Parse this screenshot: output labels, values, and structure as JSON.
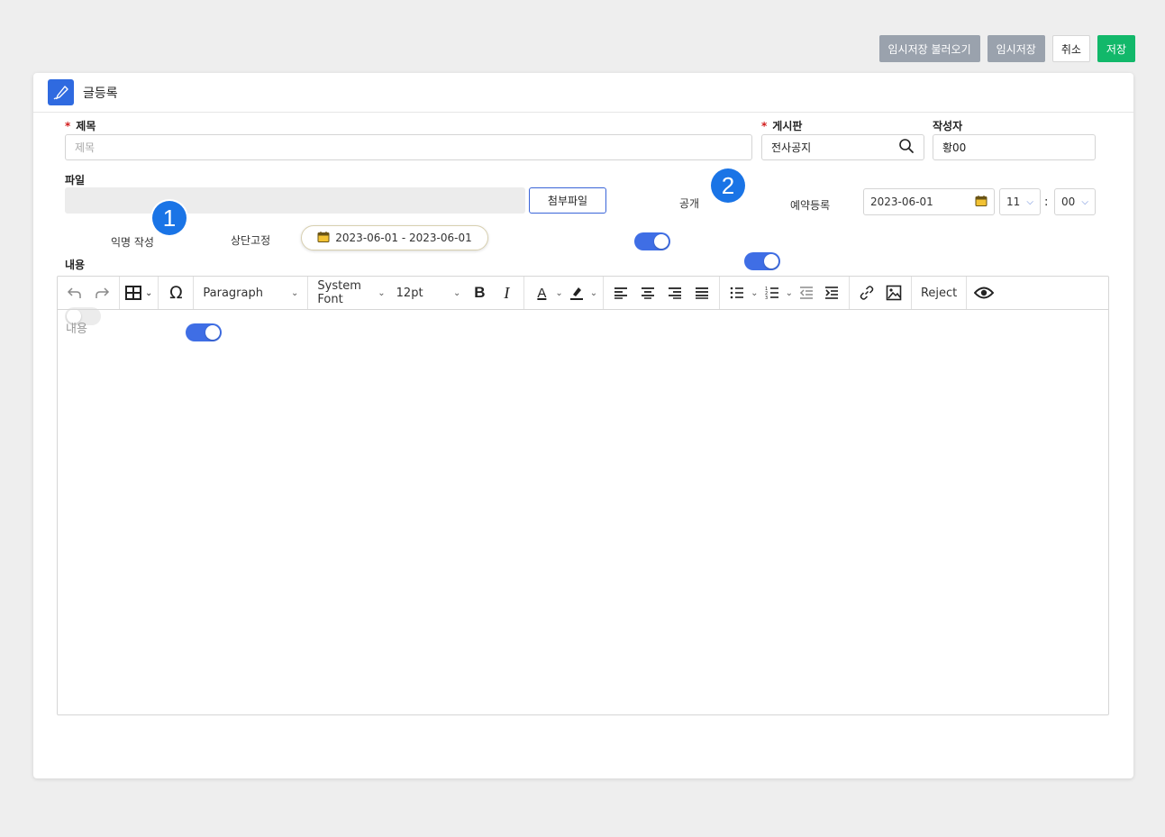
{
  "top_actions": {
    "load_draft": "임시저장 불러오기",
    "save_draft": "임시저장",
    "cancel": "취소",
    "save": "저장"
  },
  "card": {
    "title": "글등록"
  },
  "form": {
    "title_label": "제목",
    "title_placeholder": "제목",
    "board_label": "게시판",
    "board_value": "전사공지",
    "author_label": "작성자",
    "author_value": "황00",
    "file_label": "파일",
    "attach_button": "첨부파일",
    "public_label": "공개",
    "schedule_label": "예약등록",
    "schedule_date": "2023-06-01",
    "schedule_hour": "11",
    "time_separator": ":",
    "schedule_minute": "00",
    "anonymous_label": "익명 작성",
    "pin_label": "상단고정",
    "pin_date_range": "2023-06-01 - 2023-06-01",
    "content_label": "내용",
    "content_placeholder": "내용",
    "toggles": {
      "public": true,
      "schedule": true,
      "anonymous": false,
      "pin": true
    }
  },
  "markers": {
    "m1": "1",
    "m2": "2"
  },
  "toolbar": {
    "block_format": "Paragraph",
    "font_family": "System Font",
    "font_size": "12pt",
    "reject": "Reject",
    "bold": "B",
    "italic": "I",
    "text_color": "A",
    "special_char": "Ω"
  },
  "colors": {
    "accent_blue": "#3f6ee5",
    "save_green": "#12b86a",
    "draft_gray": "#9aa2ad",
    "required_red": "#d21c1c",
    "marker_blue": "#1a74e6"
  }
}
